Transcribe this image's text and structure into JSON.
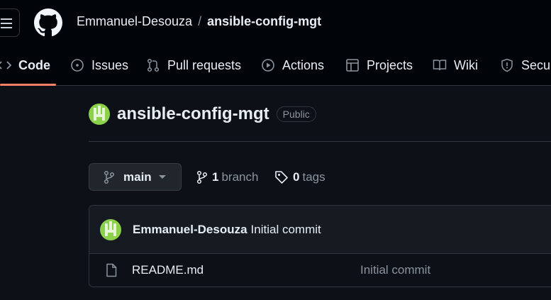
{
  "header": {
    "owner": "Emmanuel-Desouza",
    "separator": "/",
    "repo": "ansible-config-mgt"
  },
  "tabs": [
    {
      "label": "Code",
      "icon": "code-icon",
      "selected": true
    },
    {
      "label": "Issues",
      "icon": "issue-opened-icon"
    },
    {
      "label": "Pull requests",
      "icon": "git-pull-request-icon"
    },
    {
      "label": "Actions",
      "icon": "play-icon"
    },
    {
      "label": "Projects",
      "icon": "table-icon"
    },
    {
      "label": "Wiki",
      "icon": "book-icon"
    },
    {
      "label": "Secur",
      "icon": "shield-icon"
    }
  ],
  "repo": {
    "name": "ansible-config-mgt",
    "visibility": "Public"
  },
  "branch": {
    "current": "main",
    "branch_count": "1",
    "branch_label": "branch",
    "tag_count": "0",
    "tag_label": "tags"
  },
  "commit": {
    "author": "Emmanuel-Desouza",
    "message": "Initial commit"
  },
  "files": [
    {
      "name": "README.md",
      "commit_message": "Initial commit",
      "icon": "file-icon"
    }
  ],
  "colors": {
    "background": "#0d1117",
    "header_bg": "#010409",
    "accent_underline": "#f78166",
    "avatar": "#8bd14a",
    "muted_text": "#8b949e",
    "border": "#30363d"
  }
}
